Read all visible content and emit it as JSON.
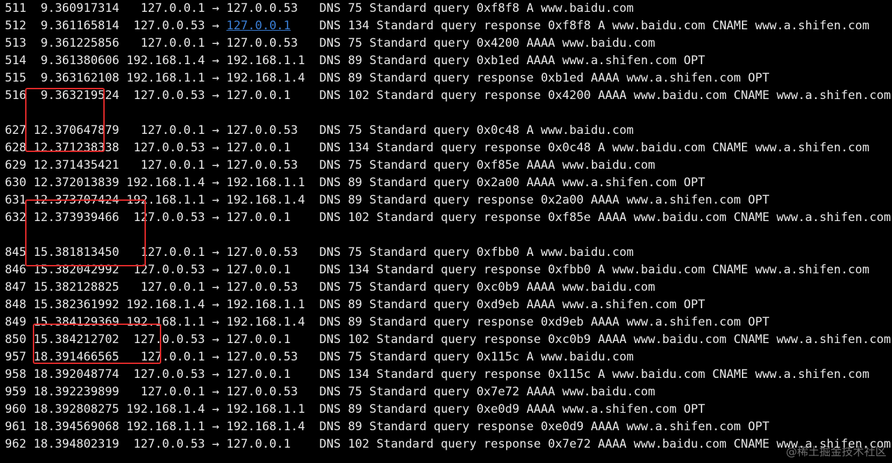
{
  "rows": [
    {
      "no": "511",
      "time": "9.360917314",
      "src": "127.0.0.1",
      "dst": "127.0.0.53",
      "proto": "DNS",
      "len": "75",
      "info": "Standard query 0xf8f8 A www.baidu.com"
    },
    {
      "no": "512",
      "time": "9.361165814",
      "src": "127.0.0.53",
      "dst": "127.0.0.1",
      "proto": "DNS",
      "len": "134",
      "info": "Standard query response 0xf8f8 A www.baidu.com CNAME www.a.shifen.com",
      "dst_link": true
    },
    {
      "no": "513",
      "time": "9.361225856",
      "src": "127.0.0.1",
      "dst": "127.0.0.53",
      "proto": "DNS",
      "len": "75",
      "info": "Standard query 0x4200 AAAA www.baidu.com"
    },
    {
      "no": "514",
      "time": "9.361380606",
      "src": "192.168.1.4",
      "dst": "192.168.1.1",
      "proto": "DNS",
      "len": "89",
      "info": "Standard query 0xb1ed AAAA www.a.shifen.com OPT"
    },
    {
      "no": "515",
      "time": "9.363162108",
      "src": "192.168.1.1",
      "dst": "192.168.1.4",
      "proto": "DNS",
      "len": "89",
      "info": "Standard query response 0xb1ed AAAA www.a.shifen.com OPT"
    },
    {
      "no": "516",
      "time": "9.363219524",
      "src": "127.0.0.53",
      "dst": "127.0.0.1",
      "proto": "DNS",
      "len": "102",
      "info": "Standard query response 0x4200 AAAA www.baidu.com CNAME www.a.shifen.com"
    },
    {
      "blank": true
    },
    {
      "no": "627",
      "time": "12.370647879",
      "src": "127.0.0.1",
      "dst": "127.0.0.53",
      "proto": "DNS",
      "len": "75",
      "info": "Standard query 0x0c48 A www.baidu.com"
    },
    {
      "no": "628",
      "time": "12.371238338",
      "src": "127.0.0.53",
      "dst": "127.0.0.1",
      "proto": "DNS",
      "len": "134",
      "info": "Standard query response 0x0c48 A www.baidu.com CNAME www.a.shifen.com"
    },
    {
      "no": "629",
      "time": "12.371435421",
      "src": "127.0.0.1",
      "dst": "127.0.0.53",
      "proto": "DNS",
      "len": "75",
      "info": "Standard query 0xf85e AAAA www.baidu.com"
    },
    {
      "no": "630",
      "time": "12.372013839",
      "src": "192.168.1.4",
      "dst": "192.168.1.1",
      "proto": "DNS",
      "len": "89",
      "info": "Standard query 0x2a00 AAAA www.a.shifen.com OPT"
    },
    {
      "no": "631",
      "time": "12.373707424",
      "src": "192.168.1.1",
      "dst": "192.168.1.4",
      "proto": "DNS",
      "len": "89",
      "info": "Standard query response 0x2a00 AAAA www.a.shifen.com OPT"
    },
    {
      "no": "632",
      "time": "12.373939466",
      "src": "127.0.0.53",
      "dst": "127.0.0.1",
      "proto": "DNS",
      "len": "102",
      "info": "Standard query response 0xf85e AAAA www.baidu.com CNAME www.a.shifen.com"
    },
    {
      "blank": true
    },
    {
      "no": "845",
      "time": "15.381813450",
      "src": "127.0.0.1",
      "dst": "127.0.0.53",
      "proto": "DNS",
      "len": "75",
      "info": "Standard query 0xfbb0 A www.baidu.com"
    },
    {
      "no": "846",
      "time": "15.382042992",
      "src": "127.0.0.53",
      "dst": "127.0.0.1",
      "proto": "DNS",
      "len": "134",
      "info": "Standard query response 0xfbb0 A www.baidu.com CNAME www.a.shifen.com"
    },
    {
      "no": "847",
      "time": "15.382128825",
      "src": "127.0.0.1",
      "dst": "127.0.0.53",
      "proto": "DNS",
      "len": "75",
      "info": "Standard query 0xc0b9 AAAA www.baidu.com"
    },
    {
      "no": "848",
      "time": "15.382361992",
      "src": "192.168.1.4",
      "dst": "192.168.1.1",
      "proto": "DNS",
      "len": "89",
      "info": "Standard query 0xd9eb AAAA www.a.shifen.com OPT"
    },
    {
      "no": "849",
      "time": "15.384129369",
      "src": "192.168.1.1",
      "dst": "192.168.1.4",
      "proto": "DNS",
      "len": "89",
      "info": "Standard query response 0xd9eb AAAA www.a.shifen.com OPT"
    },
    {
      "no": "850",
      "time": "15.384212702",
      "src": "127.0.0.53",
      "dst": "127.0.0.1",
      "proto": "DNS",
      "len": "102",
      "info": "Standard query response 0xc0b9 AAAA www.baidu.com CNAME www.a.shifen.com"
    },
    {
      "no": "957",
      "time": "18.391466565",
      "src": "127.0.0.1",
      "dst": "127.0.0.53",
      "proto": "DNS",
      "len": "75",
      "info": "Standard query 0x115c A www.baidu.com"
    },
    {
      "no": "958",
      "time": "18.392048774",
      "src": "127.0.0.53",
      "dst": "127.0.0.1",
      "proto": "DNS",
      "len": "134",
      "info": "Standard query response 0x115c A www.baidu.com CNAME www.a.shifen.com"
    },
    {
      "no": "959",
      "time": "18.392239899",
      "src": "127.0.0.1",
      "dst": "127.0.0.53",
      "proto": "DNS",
      "len": "75",
      "info": "Standard query 0x7e72 AAAA www.baidu.com"
    },
    {
      "no": "960",
      "time": "18.392808275",
      "src": "192.168.1.4",
      "dst": "192.168.1.1",
      "proto": "DNS",
      "len": "89",
      "info": "Standard query 0xe0d9 AAAA www.a.shifen.com OPT"
    },
    {
      "no": "961",
      "time": "18.394569068",
      "src": "192.168.1.1",
      "dst": "192.168.1.4",
      "proto": "DNS",
      "len": "89",
      "info": "Standard query response 0xe0d9 AAAA www.a.shifen.com OPT"
    },
    {
      "no": "962",
      "time": "18.394802319",
      "src": "127.0.0.53",
      "dst": "127.0.0.1",
      "proto": "DNS",
      "len": "102",
      "info": "Standard query response 0x7e72 AAAA www.baidu.com CNAME www.a.shifen.com"
    }
  ],
  "arrow": "→",
  "watermark": "@稀土掘金技术社区",
  "colors": {
    "background": "#000000",
    "text": "#e8e8e8",
    "link": "#3b7fd6",
    "highlight": "#e02a2a"
  }
}
